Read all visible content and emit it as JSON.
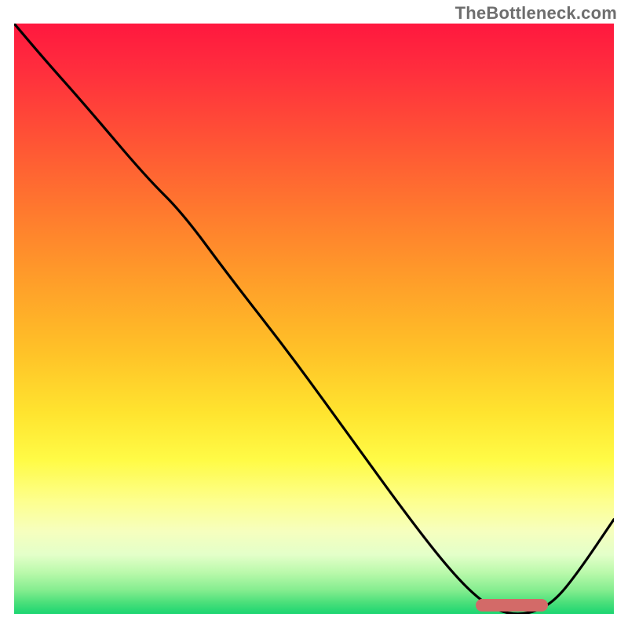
{
  "watermark": "TheBottleneck.com",
  "chart_data": {
    "type": "line",
    "title": "",
    "xlabel": "",
    "ylabel": "",
    "xlim": [
      0,
      100
    ],
    "ylim": [
      0,
      100
    ],
    "series": [
      {
        "name": "curve",
        "x": [
          0,
          5,
          12,
          22,
          28,
          36,
          46,
          56,
          66,
          73,
          78,
          82,
          86,
          90,
          94,
          100
        ],
        "values": [
          100,
          94,
          86,
          74,
          68,
          57,
          44,
          30,
          16,
          7,
          2,
          0,
          0,
          2,
          7,
          16
        ]
      }
    ],
    "highlight_bar": {
      "x_start": 77,
      "x_end": 89,
      "y": 1.5,
      "color": "#d36a68"
    },
    "background_gradient": {
      "top_color": "#ff183f",
      "mid_color": "#ffe42f",
      "bottom_color": "#1bd571"
    }
  }
}
